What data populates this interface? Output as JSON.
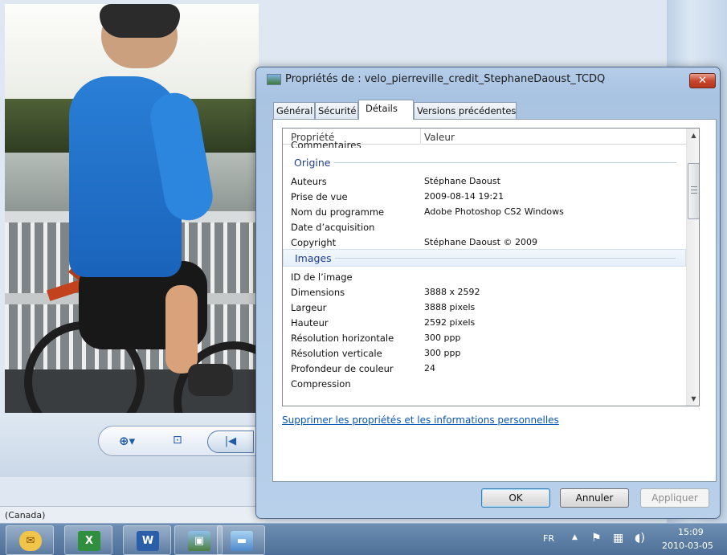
{
  "viewer": {
    "locale_label": "(Canada)",
    "zoom_icon": "zoom-icon",
    "fit_icon": "fit-window-icon",
    "prev_icon": "previous-icon"
  },
  "dialog": {
    "title": "Propriétés de : velo_pierreville_credit_StephaneDaoust_TCDQ",
    "close": "✕",
    "tabs": [
      "Général",
      "Sécurité",
      "Détails",
      "Versions précédentes"
    ],
    "active_tab": "Détails",
    "table": {
      "columns": [
        "Propriété",
        "Valeur"
      ],
      "clipped_row": "Commentaires",
      "groups": [
        {
          "name": "Origine",
          "rows": [
            {
              "property": "Auteurs",
              "value": "Stéphane Daoust"
            },
            {
              "property": "Prise de vue",
              "value": "2009-08-14 19:21"
            },
            {
              "property": "Nom du programme",
              "value": "Adobe Photoshop CS2 Windows"
            },
            {
              "property": "Date d’acquisition",
              "value": ""
            },
            {
              "property": "Copyright",
              "value": "Stéphane Daoust © 2009"
            }
          ]
        },
        {
          "name": "Images",
          "rows": [
            {
              "property": "ID de l’image",
              "value": ""
            },
            {
              "property": "Dimensions",
              "value": "3888 x 2592"
            },
            {
              "property": "Largeur",
              "value": "3888 pixels"
            },
            {
              "property": "Hauteur",
              "value": "2592 pixels"
            },
            {
              "property": "Résolution horizontale",
              "value": "300 ppp"
            },
            {
              "property": "Résolution verticale",
              "value": "300 ppp"
            },
            {
              "property": "Profondeur de couleur",
              "value": "24"
            },
            {
              "property": "Compression",
              "value": ""
            }
          ]
        }
      ]
    },
    "remove_link": "Supprimer les propriétés et les informations personnelles",
    "buttons": {
      "ok": "OK",
      "cancel": "Annuler",
      "apply": "Appliquer"
    }
  },
  "taskbar": {
    "apps": [
      "outlook-icon",
      "excel-icon",
      "word-icon",
      "photo-viewer-icon",
      "photo-gallery-icon"
    ],
    "app_glyphs": [
      "✉",
      "X",
      "W",
      "▣",
      "▬"
    ],
    "language": "FR",
    "time": "15:09",
    "date": "2010-03-05"
  },
  "colors": {
    "link": "#0a56b3",
    "group_label": "#1e3f8a",
    "close_button": "#c9462d",
    "taskbar": "#5a7ca3"
  }
}
